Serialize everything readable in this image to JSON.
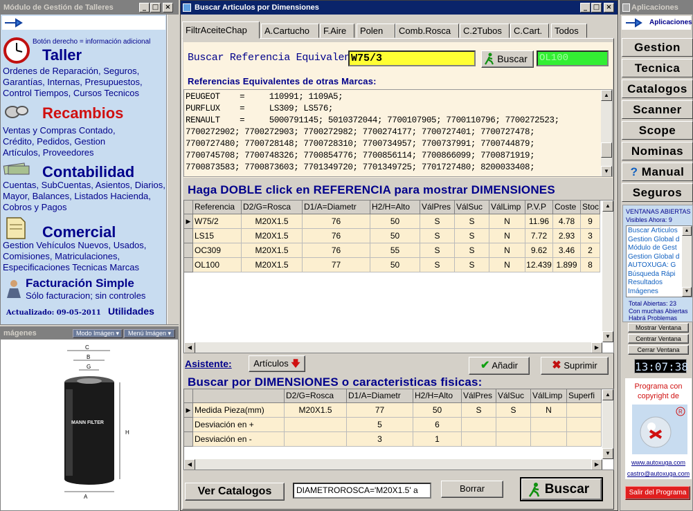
{
  "left_window": {
    "title": "Módulo de Gestión de Talleres",
    "hint": "Botón derecho = información adicional",
    "taller": {
      "title": "Taller",
      "desc": "Ordenes de Reparación, Seguros, Garantías, Internas, Presupuestos, Control Tiempos, Cursos Tecnicos"
    },
    "recambios": {
      "title": "Recambios",
      "desc": "Ventas y Compras Contado, Crédito, Pedidos, Gestion Artículos, Proveedores"
    },
    "contabilidad": {
      "title": "Contabilidad",
      "desc": "Cuentas, SubCuentas, Asientos, Diarios, Mayor, Balances, Listados Hacienda, Cobros y Pagos"
    },
    "comercial": {
      "title": "Comercial",
      "desc": "Gestion Vehículos Nuevos, Usados, Comisiones, Matriculaciones, Especificaciones Tecnicas Marcas"
    },
    "facturacion": {
      "title": "Facturación Simple",
      "desc": "Sólo facturacion; sin controles"
    },
    "updated": "Actualizado: 09-05-2011",
    "utilidades": "Utilidades"
  },
  "images_window": {
    "title": "mágenes",
    "modo": "Modo Imágen",
    "menu": "Menú Imágen",
    "labels": [
      "C",
      "B",
      "G",
      "A",
      "H",
      "A"
    ],
    "filter_brand": "MANN FILTER"
  },
  "main_window": {
    "title": "Buscar Articulos por Dimensiones",
    "tabs": [
      "FiltrAceiteChap",
      "A.Cartucho",
      "F.Aire",
      "Polen",
      "Comb.Rosca",
      "C.2Tubos",
      "C.Cart.",
      "Todos"
    ],
    "search_label": "Buscar Referencia Equivalente:",
    "search_value": "W75/3",
    "search_button": "Buscar",
    "result_field": "OL100",
    "equiv_label": "Referencias Equivalentes de otras Marcas:",
    "equiv_text": [
      "PEUGEOT    =     110991; 1109A5;",
      "PURFLUX    =     LS309; LS576;",
      "RENAULT    =     5000791145; 5010372044; 7700107905; 7700110796; 7700272523;",
      "7700272902; 7700272903; 7700272982; 7700274177; 7700727401; 7700727478;",
      "7700727480; 7700728148; 7700728310; 7700734957; 7700737991; 7700744879;",
      "7700745708; 7700748326; 7700854776; 7700856114; 7700866099; 7700871919;",
      "7700873583; 7700873603; 7701349720; 7701349725; 7701727480; 8200033408;"
    ],
    "dbl_click_title": "Haga DOBLE click en REFERENCIA para mostrar DIMENSIONES",
    "results_columns": [
      "Referencia",
      "D2/G=Rosca",
      "D1/A=Diametr",
      "H2/H=Alto",
      "VálPres",
      "VálSuc",
      "VálLimp",
      "P.V.P",
      "Coste",
      "Stoc"
    ],
    "results_rows": [
      [
        "W75/2",
        "M20X1.5",
        "76",
        "50",
        "S",
        "S",
        "N",
        "11.96",
        "4.78",
        "9"
      ],
      [
        "LS15",
        "M20X1.5",
        "76",
        "50",
        "S",
        "S",
        "N",
        "7.72",
        "2.93",
        "3"
      ],
      [
        "OC309",
        "M20X1.5",
        "76",
        "55",
        "S",
        "S",
        "N",
        "9.62",
        "3.46",
        "2"
      ],
      [
        "OL100",
        "M20X1.5",
        "77",
        "50",
        "S",
        "S",
        "N",
        "12.439",
        "1.899",
        "8"
      ]
    ],
    "asistente_label": "Asistente:",
    "articulos_button": "Artículos",
    "anadir_button": "Añadir",
    "suprimir_button": "Suprimir",
    "dims_title": "Buscar por DIMENSIONES o caracteristicas fisicas:",
    "dims_columns": [
      "",
      "D2/G=Rosca",
      "D1/A=Diametr",
      "H2/H=Alto",
      "VálPres",
      "VálSuc",
      "VálLimp",
      "Superfi"
    ],
    "dims_rows": [
      [
        "Medida Pieza(mm)",
        "M20X1.5",
        "77",
        "50",
        "S",
        "S",
        "N",
        ""
      ],
      [
        "Desviación en +",
        "",
        "5",
        "6",
        "",
        "",
        "",
        ""
      ],
      [
        "Desviación en -",
        "",
        "3",
        "1",
        "",
        "",
        "",
        ""
      ]
    ],
    "ver_catalogos": "Ver Catalogos",
    "filter_expr": "DIAMETROROSCA='M20X1.5' a",
    "borrar": "Borrar",
    "buscar_big": "Buscar"
  },
  "right_window": {
    "title": "Aplicaciones",
    "header": "Aplicaciones",
    "nav": [
      "Gestion",
      "Tecnica",
      "Catalogos",
      "Scanner",
      "Scope",
      "Nominas",
      "Manual",
      "Seguros"
    ],
    "ventanas_label": "VENTANAS ABIERTAS",
    "visibles": "Visibles Ahora: 9",
    "open_windows": [
      "Buscar Articulos",
      "Gestion Global d",
      "Módulo de Gest",
      "Gestion Global d",
      "AUTOXUGA:  G",
      "Búsqueda Rápi",
      "Resultados",
      "Imágenes"
    ],
    "total": "Total Abiertas: 23",
    "warning1": "Con muchas Abiertas",
    "warning2": "Habrá Problemas",
    "mostrar": "Mostrar Ventana",
    "centrar": "Centrar Ventana",
    "cerrar": "Cerrar Ventana",
    "clock": "13:07:38",
    "copyright1": "Programa con",
    "copyright2": "copyright de",
    "website": "www.autoxuga.com",
    "email": "castro@autoxuga.com",
    "exit": "Salir del Programa"
  },
  "colors": {
    "title_active": "#0a246a",
    "accent_blue": "#00008b",
    "yellow_field": "#ffff33",
    "green_field": "#33ee33",
    "cell_bg": "#fcefd0",
    "red_title": "#d01010"
  }
}
